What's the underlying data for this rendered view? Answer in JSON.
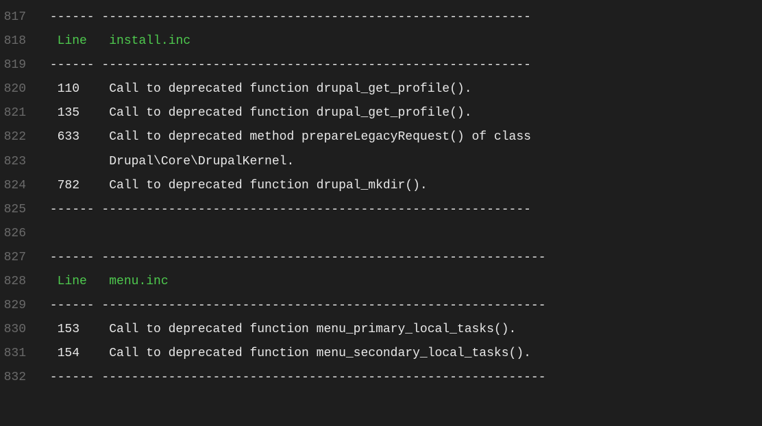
{
  "lines": [
    {
      "num": "817",
      "segments": [
        {
          "text": " ------ ---------------------------------------------------------- ",
          "class": "white"
        }
      ]
    },
    {
      "num": "818",
      "segments": [
        {
          "text": "  ",
          "class": "white"
        },
        {
          "text": "Line",
          "class": "green"
        },
        {
          "text": "   ",
          "class": "white"
        },
        {
          "text": "install.inc",
          "class": "green"
        }
      ]
    },
    {
      "num": "819",
      "segments": [
        {
          "text": " ------ ---------------------------------------------------------- ",
          "class": "white"
        }
      ]
    },
    {
      "num": "820",
      "segments": [
        {
          "text": "  110    Call to deprecated function drupal_get_profile().",
          "class": "white"
        }
      ]
    },
    {
      "num": "821",
      "segments": [
        {
          "text": "  135    Call to deprecated function drupal_get_profile().",
          "class": "white"
        }
      ]
    },
    {
      "num": "822",
      "segments": [
        {
          "text": "  633    Call to deprecated method prepareLegacyRequest() of class",
          "class": "white"
        }
      ]
    },
    {
      "num": "823",
      "segments": [
        {
          "text": "         Drupal\\Core\\DrupalKernel.",
          "class": "white"
        }
      ]
    },
    {
      "num": "824",
      "segments": [
        {
          "text": "  782    Call to deprecated function drupal_mkdir().",
          "class": "white"
        }
      ]
    },
    {
      "num": "825",
      "segments": [
        {
          "text": " ------ ---------------------------------------------------------- ",
          "class": "white"
        }
      ]
    },
    {
      "num": "826",
      "segments": [
        {
          "text": "",
          "class": "white"
        }
      ]
    },
    {
      "num": "827",
      "segments": [
        {
          "text": " ------ ------------------------------------------------------------ ",
          "class": "white"
        }
      ]
    },
    {
      "num": "828",
      "segments": [
        {
          "text": "  ",
          "class": "white"
        },
        {
          "text": "Line",
          "class": "green"
        },
        {
          "text": "   ",
          "class": "white"
        },
        {
          "text": "menu.inc",
          "class": "green"
        }
      ]
    },
    {
      "num": "829",
      "segments": [
        {
          "text": " ------ ------------------------------------------------------------ ",
          "class": "white"
        }
      ]
    },
    {
      "num": "830",
      "segments": [
        {
          "text": "  153    Call to deprecated function menu_primary_local_tasks().",
          "class": "white"
        }
      ]
    },
    {
      "num": "831",
      "segments": [
        {
          "text": "  154    Call to deprecated function menu_secondary_local_tasks().",
          "class": "white"
        }
      ]
    },
    {
      "num": "832",
      "segments": [
        {
          "text": " ------ ------------------------------------------------------------ ",
          "class": "white"
        }
      ]
    }
  ]
}
